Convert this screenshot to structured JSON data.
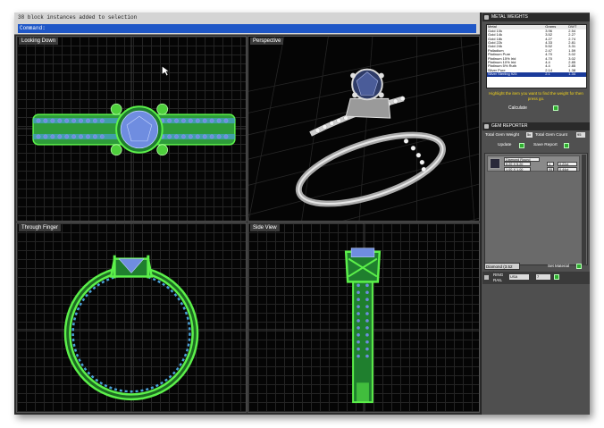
{
  "command": {
    "history_text": "38 block instances added to selection",
    "prompt": "Command:"
  },
  "viewports": [
    {
      "label": "Looking Down"
    },
    {
      "label": "Perspective"
    },
    {
      "label": "Through Finger"
    },
    {
      "label": "Side View"
    }
  ],
  "metal_weights": {
    "title": "METAL WEIGHTS",
    "columns": [
      "Metal",
      "Grams",
      "DWT"
    ],
    "rows": [
      [
        "Gold 10k",
        "3.96",
        "2.54"
      ],
      [
        "Gold 14k",
        "3.52",
        "2.27"
      ],
      [
        "Gold 18k",
        "4.27",
        "2.74"
      ],
      [
        "Gold 22k",
        "4.33",
        "2.81"
      ],
      [
        "Gold 24k",
        "5.52",
        "3.31"
      ],
      [
        "Palladium",
        "2.47",
        "1.59"
      ],
      [
        "Platinum Pure",
        "4.70",
        "3.02"
      ],
      [
        "Platinum 15% Irid",
        "4.70",
        "3.02"
      ],
      [
        "Platinum 10% Irid",
        "4.4",
        "2.85"
      ],
      [
        "Platinum 5% Ruth",
        "4.4",
        "2.85"
      ],
      [
        "Silver Pure",
        "2.14",
        "1.38"
      ],
      [
        "Silver Sterling 925",
        "2.1",
        "1.34"
      ]
    ],
    "selected_row": 11,
    "hint": "Highlight the item you want to find the weight for then press go.",
    "calculate_label": "Calculate"
  },
  "gem_reporter": {
    "title": "GEM REPORTER",
    "total_weight_label": "Total Gem Weight",
    "total_weight_value": "5c",
    "total_count_label": "Total Gem Count",
    "total_count_value": "95",
    "update_label": "Update",
    "save_report_label": "Save Report",
    "gem_name": "Diamond Round",
    "gem_row1_size": "5.20 X 5.20",
    "gem_row1_count": "1",
    "gem_row1_weight": "0.22ct",
    "gem_row2_size": "1.00 X 1.00",
    "gem_row2_count": "95",
    "gem_row2_weight": "0.44ct",
    "gem_select": "Diamond (3.52 g/cc)",
    "set_material_label": "Set Material"
  },
  "ring_rail": {
    "label_line1": "RING",
    "label_line2": "RAIL",
    "standard": "USA",
    "size": "7"
  },
  "colors": {
    "wire_green": "#5cf04a",
    "gem_blue": "#6f8de0",
    "panel_bg": "#505050",
    "accent_yellow": "#f1d21a",
    "command_blue": "#1f57c7"
  }
}
